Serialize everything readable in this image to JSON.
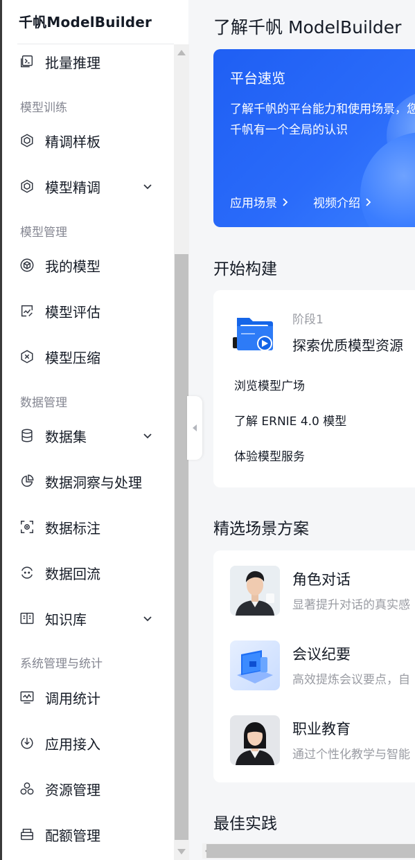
{
  "sidebar": {
    "brand": "千帆ModelBuilder",
    "items": [
      {
        "label": "批量推理",
        "icon": "batch-inference-icon"
      },
      {
        "group": "模型训练"
      },
      {
        "label": "精调样板",
        "icon": "finetune-template-icon"
      },
      {
        "label": "模型精调",
        "icon": "model-finetune-icon",
        "expandable": true
      },
      {
        "group": "模型管理"
      },
      {
        "label": "我的模型",
        "icon": "my-model-icon"
      },
      {
        "label": "模型评估",
        "icon": "model-eval-icon"
      },
      {
        "label": "模型压缩",
        "icon": "model-compress-icon"
      },
      {
        "group": "数据管理"
      },
      {
        "label": "数据集",
        "icon": "dataset-icon",
        "expandable": true
      },
      {
        "label": "数据洞察与处理",
        "icon": "data-insight-icon"
      },
      {
        "label": "数据标注",
        "icon": "data-annotation-icon"
      },
      {
        "label": "数据回流",
        "icon": "data-reflow-icon"
      },
      {
        "label": "知识库",
        "icon": "knowledge-base-icon",
        "expandable": true
      },
      {
        "group": "系统管理与统计"
      },
      {
        "label": "调用统计",
        "icon": "call-stats-icon"
      },
      {
        "label": "应用接入",
        "icon": "app-access-icon"
      },
      {
        "label": "资源管理",
        "icon": "resource-icon"
      },
      {
        "label": "配额管理",
        "icon": "quota-icon"
      }
    ]
  },
  "main": {
    "title": "了解千帆 ModelBuilder",
    "banner": {
      "title": "平台速览",
      "desc": "了解千帆的平台能力和使用场景，您对千帆有一个全局的认识",
      "link1": "应用场景",
      "link2": "视频介绍"
    },
    "start": {
      "title": "开始构建",
      "stage_label": "阶段1",
      "stage_title": "探索优质模型资源",
      "links": [
        "浏览模型广场",
        "了解 ERNIE 4.0 模型",
        "体验模型服务"
      ]
    },
    "scenes": {
      "title": "精选场景方案",
      "items": [
        {
          "title": "角色对话",
          "desc": "显著提升对话的真实感"
        },
        {
          "title": "会议纪要",
          "desc": "高效提炼会议要点，自"
        },
        {
          "title": "职业教育",
          "desc": "通过个性化教学与智能"
        }
      ]
    },
    "best_practice": {
      "title": "最佳实践"
    }
  },
  "colors": {
    "accent": "#2468f2",
    "text": "#151b26",
    "muted": "#848691"
  }
}
